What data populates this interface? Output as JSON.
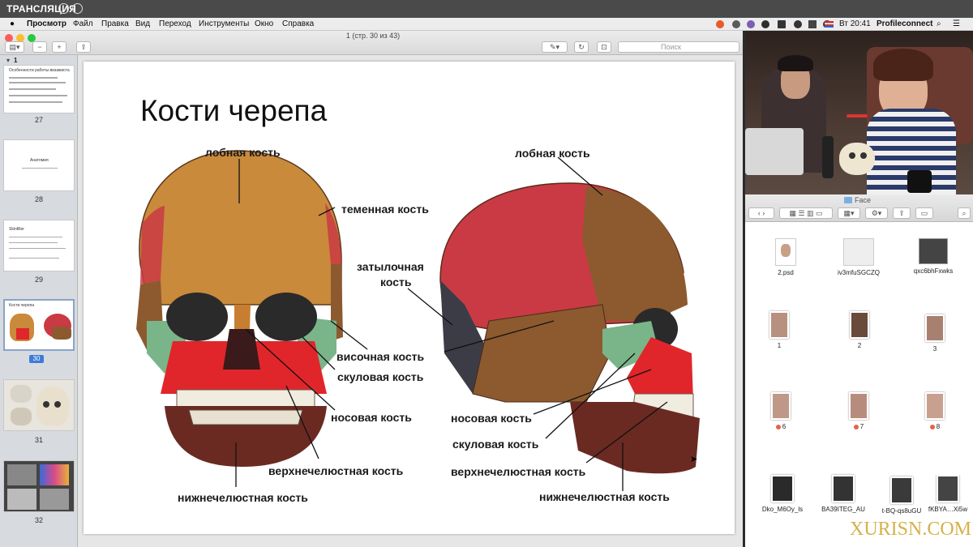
{
  "stream": {
    "title": "ТРАНСЛЯЦИЯ"
  },
  "menubar": {
    "apple": "",
    "app": "Просмотр",
    "items": [
      "Файл",
      "Правка",
      "Вид",
      "Переход",
      "Инструменты",
      "Окно",
      "Справка"
    ],
    "clock": "Вт 20:41",
    "user": "Profileconnect"
  },
  "preview": {
    "doc_title": "1 (стр. 30 из 43)",
    "search_placeholder": "Поиск",
    "sidebar": {
      "section": "1",
      "thumbs": [
        {
          "num": "27",
          "title": "Особенности работы визажиста"
        },
        {
          "num": "28",
          "title": "Анатомия"
        },
        {
          "num": "29",
          "title": "Skinfiller"
        },
        {
          "num": "30",
          "title": "Кости черепа",
          "selected": true
        },
        {
          "num": "31",
          "title": ""
        },
        {
          "num": "32",
          "title": ""
        }
      ]
    },
    "slide": {
      "title": "Кости черепа",
      "front_labels": {
        "frontal": "лобная кость",
        "parietal": "теменная кость",
        "occipital_1": "затылочная",
        "occipital_2": "кость",
        "temporal": "височная кость",
        "zygomatic": "скуловая кость",
        "nasal": "носовая кость",
        "maxilla": "верхнечелюстная кость",
        "mandible": "нижнечелюстная кость"
      },
      "side_labels": {
        "frontal": "лобная кость",
        "nasal": "носовая кость",
        "zygomatic": "скуловая кость",
        "maxilla": "верхнечелюстная кость",
        "mandible": "нижнечелюстная кость"
      }
    }
  },
  "finder": {
    "title": "Face",
    "items": [
      {
        "label": "2.psd",
        "tag": false
      },
      {
        "label": "iv3mfuSGCZQ",
        "tag": false
      },
      {
        "label": "qxc6bhFxwks",
        "tag": false
      },
      {
        "label": "1",
        "tag": false
      },
      {
        "label": "2",
        "tag": false
      },
      {
        "label": "3",
        "tag": false
      },
      {
        "label": "6",
        "tag": true
      },
      {
        "label": "7",
        "tag": true
      },
      {
        "label": "8",
        "tag": true
      },
      {
        "label": "Dko_M6Oy_ls",
        "tag": false
      },
      {
        "label": "BA39ITEG_AU",
        "tag": false
      },
      {
        "label": "t-BQ-qs8uGU",
        "tag": false
      },
      {
        "label": "fKBYA…Xi5w",
        "tag": false
      }
    ]
  },
  "watermark": "XURISN.COM",
  "colors": {
    "frontal": "#c98a3c",
    "parietal": "#c93a44",
    "temporal": "#8c5a2e",
    "zygomatic": "#7ab58a",
    "maxilla": "#e0262a",
    "mandible": "#6a2a22",
    "occipital": "#3c3c46"
  }
}
